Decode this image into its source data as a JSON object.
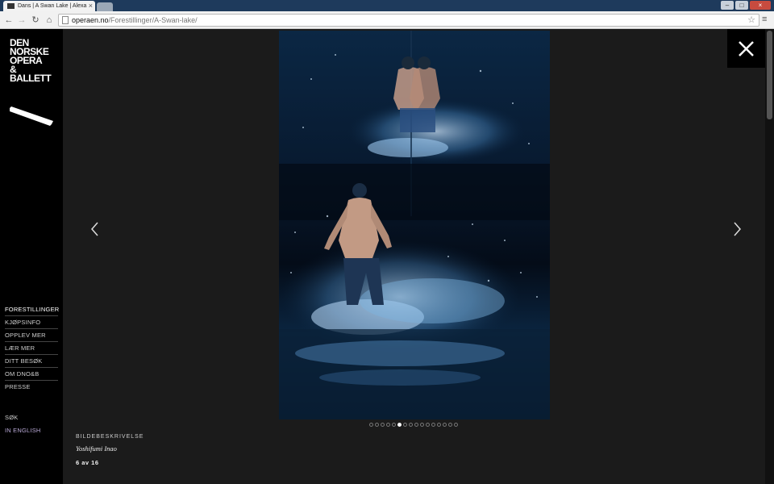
{
  "browser": {
    "tab_title": "Dans | A Swan Lake | Alexa",
    "url_host": "operaen.no",
    "url_path": "/Forestillinger/A-Swan-lake/"
  },
  "logo": {
    "lines": [
      "DEN",
      "NORSKE",
      "OPERA",
      "&",
      "BALLETT"
    ]
  },
  "nav": {
    "primary": [
      {
        "label": "FORESTILLINGER",
        "active": true
      },
      {
        "label": "KJØPSINFO"
      },
      {
        "label": "OPPLEV MER"
      },
      {
        "label": "LÆR MER"
      },
      {
        "label": "DITT BESØK"
      },
      {
        "label": "OM DNO&B"
      },
      {
        "label": "PRESSE"
      }
    ],
    "search_label": "SØK",
    "english_label": "IN ENGLISH"
  },
  "gallery": {
    "caption_label": "BILDEBESKRIVELSE",
    "caption": "Yoshifumi Inao",
    "counter": "6 av 16",
    "current": 6,
    "total": 16
  },
  "colors": {
    "accent": "#ffffff",
    "viewer_bg": "#1b1b1b",
    "english_link": "#b9a9d6"
  }
}
